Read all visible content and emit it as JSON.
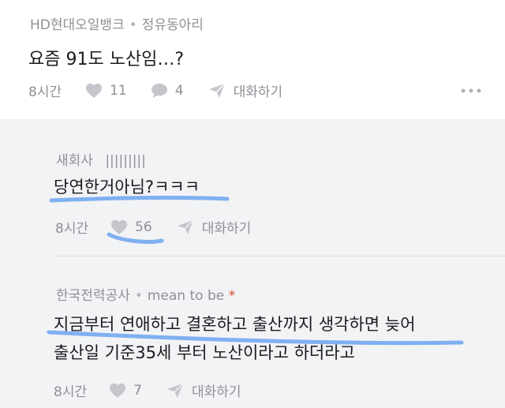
{
  "post": {
    "company": "HD현대오일뱅크",
    "separator": "•",
    "author": "정유동아리",
    "title": "요즘 91도 노산임…?",
    "time": "8시간",
    "likes": "11",
    "comments": "4",
    "reply_label": "대화하기"
  },
  "comments": [
    {
      "company": "새회사",
      "author": "|||||||||",
      "text_lines": [
        "당연한거아님?ㅋㅋㅋ"
      ],
      "time": "8시간",
      "likes": "56",
      "reply_label": "대화하기"
    },
    {
      "company": "한국전력공사",
      "separator": "•",
      "author": "mean to be",
      "author_mark": "*",
      "text_lines": [
        "지금부터 연애하고 결혼하고 출산까지 생각하면 늦어",
        "출산일 기준35세 부터 노산이라고 하더라고"
      ],
      "time": "8시간",
      "likes": "7",
      "reply_label": "대화하기"
    }
  ],
  "colors": {
    "highlight": "#7fb0f0",
    "author_mark": "#e0473a"
  },
  "icons": [
    "heart-icon",
    "speech-bubble-icon",
    "paper-plane-icon",
    "more-dots-icon"
  ]
}
